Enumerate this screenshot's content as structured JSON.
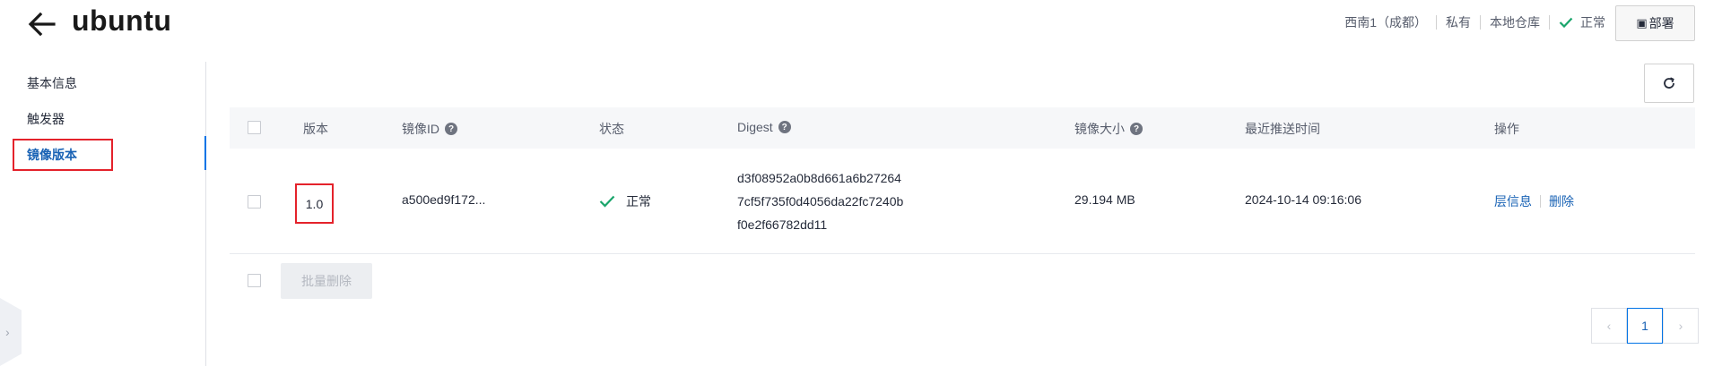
{
  "header": {
    "title": "ubuntu",
    "region": "西南1（成都）",
    "visibility": "私有",
    "repo_type": "本地仓库",
    "status": "正常",
    "deploy_label": "部署",
    "deploy_icon": "cube-icon"
  },
  "sidebar": {
    "items": [
      {
        "label": "基本信息"
      },
      {
        "label": "触发器"
      },
      {
        "label": "镜像版本"
      }
    ],
    "active_index": 2
  },
  "table": {
    "columns": {
      "version": "版本",
      "image_id": "镜像ID",
      "status": "状态",
      "digest": "Digest",
      "size": "镜像大小",
      "pushed_at": "最近推送时间",
      "actions": "操作"
    },
    "rows": [
      {
        "version": "1.0",
        "image_id": "a500ed9f172...",
        "status": "正常",
        "digest_lines": [
          "d3f08952a0b8d661a6b27264",
          "7cf5f735f0d4056da22fc7240b",
          "f0e2f66782dd11"
        ],
        "size": "29.194 MB",
        "pushed_at": "2024-10-14 09:16:06",
        "action_layers": "层信息",
        "action_delete": "删除"
      }
    ],
    "bulk_delete_label": "批量删除"
  },
  "pagination": {
    "current_page": "1"
  },
  "colors": {
    "accent": "#1a63b5",
    "ok_green": "#1aa56b",
    "highlight_red": "#e4222b"
  }
}
